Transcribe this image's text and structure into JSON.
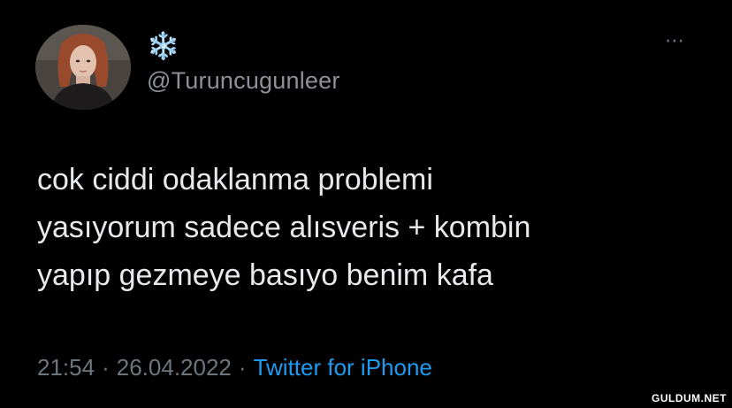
{
  "author": {
    "display_name": "❄️",
    "handle": "@Turuncugunleer",
    "avatar": "profile-photo"
  },
  "menu_icon": "⋯",
  "tweet": {
    "lines": [
      "cok ciddi odaklanma problemi",
      "yasıyorum sadece alısveris + kombin",
      "yapıp gezmeye basıyo benim kafa"
    ]
  },
  "meta": {
    "time": "21:54",
    "separator": "·",
    "date": "26.04.2022",
    "source": "Twitter for iPhone"
  },
  "watermark": "GULDUM.NET",
  "colors": {
    "background": "#000000",
    "text": "#e7e9ea",
    "secondary": "#6e767d",
    "link": "#1d9bf0"
  }
}
